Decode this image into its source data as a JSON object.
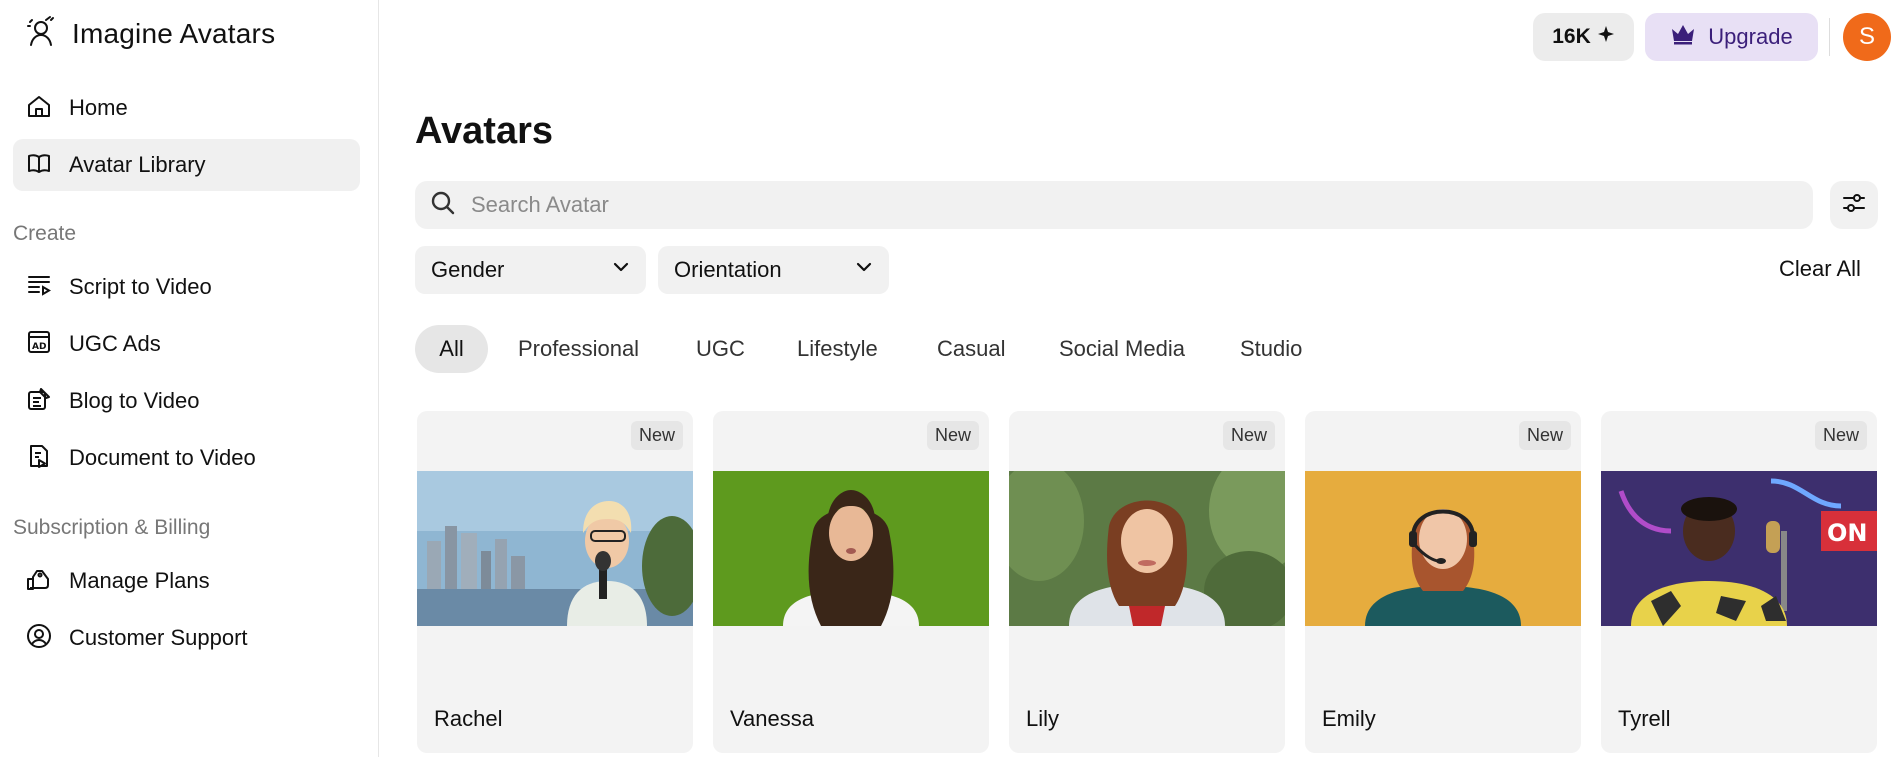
{
  "brand": {
    "name": "Imagine Avatars",
    "icon": "avatar-logo-icon"
  },
  "sidebar": {
    "main": [
      {
        "label": "Home",
        "icon": "home-icon",
        "active": false
      },
      {
        "label": "Avatar Library",
        "icon": "book-open-icon",
        "active": true
      }
    ],
    "create_title": "Create",
    "create": [
      {
        "label": "Script to Video",
        "icon": "script-lines-icon"
      },
      {
        "label": "UGC Ads",
        "icon": "ad-icon"
      },
      {
        "label": "Blog to Video",
        "icon": "blog-edit-icon"
      },
      {
        "label": "Document to Video",
        "icon": "document-play-icon"
      }
    ],
    "billing_title": "Subscription & Billing",
    "billing": [
      {
        "label": "Manage Plans",
        "icon": "tag-hand-icon"
      },
      {
        "label": "Customer Support",
        "icon": "user-circle-icon"
      }
    ]
  },
  "topbar": {
    "credits": "16K",
    "upgrade_label": "Upgrade",
    "avatar_initial": "S",
    "accent_upgrade": "#e8e0f5",
    "avatar_color": "#f06a1a"
  },
  "main": {
    "title": "Avatars",
    "search_placeholder": "Search Avatar",
    "filters": {
      "gender": "Gender",
      "orientation": "Orientation",
      "clear_all": "Clear All"
    },
    "categories": [
      "All",
      "Professional",
      "UGC",
      "Lifestyle",
      "Casual",
      "Social Media",
      "Studio"
    ],
    "active_category": "All",
    "cards": [
      {
        "name": "Rachel",
        "badge": "New"
      },
      {
        "name": "Vanessa",
        "badge": "New"
      },
      {
        "name": "Lily",
        "badge": "New"
      },
      {
        "name": "Emily",
        "badge": "New"
      },
      {
        "name": "Tyrell",
        "badge": "New"
      }
    ]
  }
}
